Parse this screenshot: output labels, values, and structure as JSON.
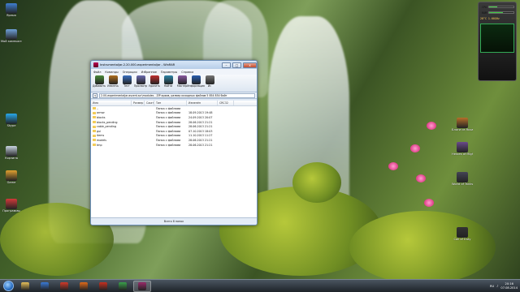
{
  "winrar": {
    "title": "Instrumentaljar-2.20.000-experimentaljar - WinRAR",
    "menu": [
      "Файл",
      "Команды",
      "Операции",
      "Избранное",
      "Параметры",
      "Справка"
    ],
    "toolbar": [
      "Добавить",
      "Извлечь",
      "Тест",
      "Просмотр",
      "Удалить",
      "Найти",
      "Мастер",
      "Информация",
      "Ис"
    ],
    "path": "2.00-experimentaljar.ascent.scr\\modules - ZIP архив, размер исходных файлов 5 854 854 байт",
    "columns": [
      "Имя",
      "Размер",
      "Сжат",
      "Тип",
      "Изменён",
      "CRC32"
    ],
    "rows": [
      {
        "name": "..",
        "size": "",
        "packed": "",
        "type": "Папка с файлами",
        "modified": "",
        "crc": ""
      },
      {
        "name": "armor",
        "size": "",
        "packed": "",
        "type": "Папка с файлами",
        "modified": "18.09.2013 19:48",
        "crc": ""
      },
      {
        "name": "blocks",
        "size": "",
        "packed": "",
        "type": "Папка с файлами",
        "modified": "24.09.2013 20:07",
        "crc": ""
      },
      {
        "name": "blocks_pending",
        "size": "",
        "packed": "",
        "type": "Папка с файлами",
        "modified": "28.06.2013 21:21",
        "crc": ""
      },
      {
        "name": "cable_pending",
        "size": "",
        "packed": "",
        "type": "Папка с файлами",
        "modified": "28.06.2013 21:21",
        "crc": ""
      },
      {
        "name": "gui",
        "size": "",
        "packed": "",
        "type": "Папка с файлами",
        "modified": "07.10.2013 18:03",
        "crc": ""
      },
      {
        "name": "items",
        "size": "",
        "packed": "",
        "type": "Папка с файлами",
        "modified": "11.10.2013 11:27",
        "crc": ""
      },
      {
        "name": "models",
        "size": "",
        "packed": "",
        "type": "Папка с файлами",
        "modified": "28.06.2013 21:21",
        "crc": ""
      },
      {
        "name": "tmp",
        "size": "",
        "packed": "",
        "type": "Папка с файлами",
        "modified": "28.06.2013 21:21",
        "crc": ""
      }
    ],
    "status": "Всего 8 папок"
  },
  "desktop_icons": [
    {
      "label": "Ярлык",
      "color": "#3f7fd1"
    },
    {
      "label": "Мой компьютер",
      "color": "#6fa0d8"
    },
    {
      "label": "Skype",
      "color": "#28a8ea"
    },
    {
      "label": "Корзина",
      "color": "#c8d4e0"
    },
    {
      "label": "Game",
      "color": "#e0a030"
    },
    {
      "label": "Программы",
      "color": "#d23a3a"
    }
  ],
  "right_icons": [
    {
      "label": "Блоги из Rusak",
      "color": "#b5702a"
    },
    {
      "label": "Heroes of Might & Magic",
      "color": "#6a4a8a"
    },
    {
      "label": "World of Tanks",
      "color": "#445"
    },
    {
      "label": "Call of Duty",
      "color": "#333"
    }
  ],
  "gadget": {
    "cpu_label": "CPU",
    "cpu_pct": 0.32,
    "ram_label": "RAM",
    "ram_pct": 0.58,
    "readout": "28°C 1.60GHz"
  },
  "taskbar": {
    "apps": [
      "explorer",
      "media",
      "opera",
      "firefox",
      "filezilla",
      "chrome",
      "winrar"
    ],
    "lang": "RU",
    "time": "20:16",
    "date": "07.08.2014"
  }
}
